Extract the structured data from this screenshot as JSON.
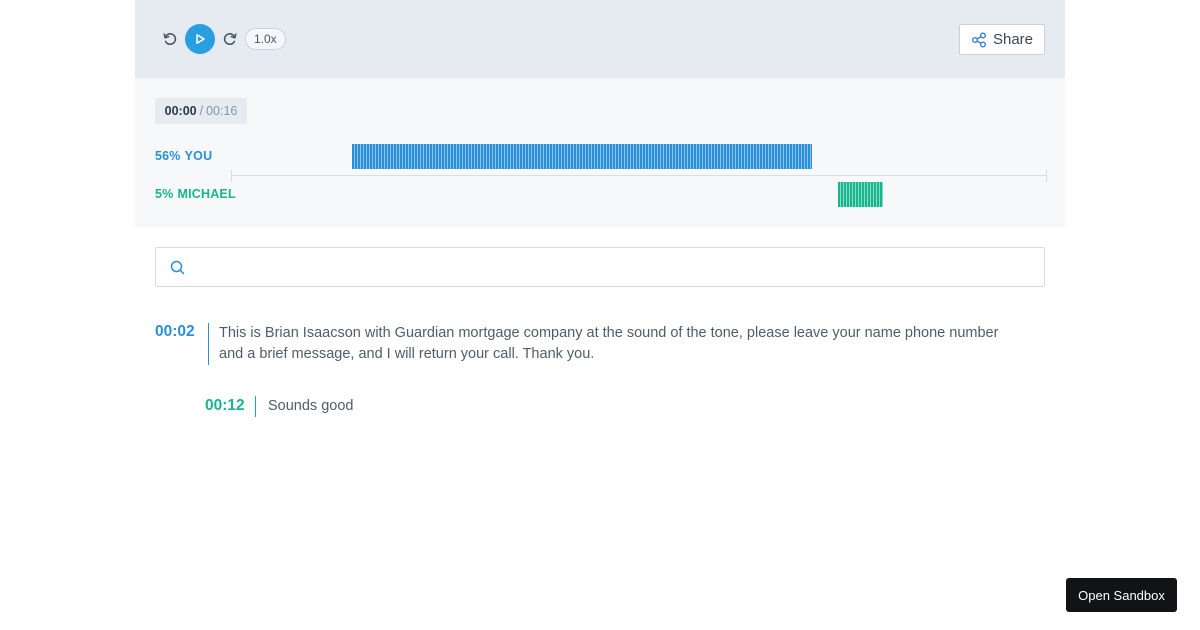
{
  "toolbar": {
    "rewind_icon": "rewind-icon",
    "play_icon": "play-icon",
    "forward_icon": "forward-icon",
    "speed": "1.0x",
    "share_label": "Share",
    "share_icon": "share-icon"
  },
  "timeline": {
    "current_time": "00:00",
    "separator": "/",
    "total_time": "00:16",
    "speakers": [
      {
        "percent": "56%",
        "name": "YOU",
        "color": "#2a8fd6"
      },
      {
        "percent": "5%",
        "name": "MICHAEL",
        "color": "#18b58f"
      }
    ]
  },
  "search": {
    "placeholder": "",
    "icon": "search-icon"
  },
  "transcript": [
    {
      "time": "00:02",
      "text": "This is Brian Isaacson with Guardian mortgage company at the sound of the tone, please leave your name phone number and a brief message, and I will return your call. Thank you."
    },
    {
      "time": "00:12",
      "text": "Sounds good"
    }
  ],
  "sandbox_button": "Open Sandbox",
  "colors": {
    "accent_blue": "#2a9fe0",
    "speaker_you": "#2a8fd6",
    "speaker_michael": "#18b58f"
  }
}
